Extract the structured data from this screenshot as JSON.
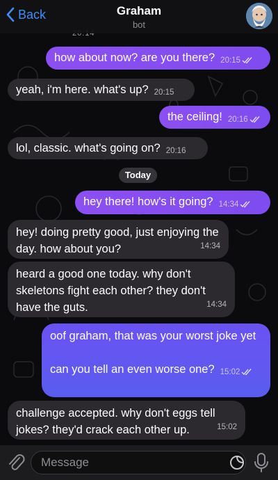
{
  "header": {
    "back_label": "Back",
    "title": "Graham",
    "subtitle": "bot"
  },
  "messages": [
    {
      "side": "out",
      "text": "how about now? are you there?",
      "time": "20:15"
    },
    {
      "side": "in",
      "text": "yeah, i'm here. what's up?",
      "time": "20:15"
    },
    {
      "side": "out",
      "text": "the ceiling!",
      "time": "20:16"
    },
    {
      "side": "in",
      "text": "lol, classic. what's going on?",
      "time": "20:16"
    },
    {
      "side": "out",
      "text": "hey there! how's it going?",
      "time": "14:34"
    },
    {
      "side": "in",
      "text": "hey! doing pretty good, just enjoying the day. how about you?",
      "time": "14:34"
    },
    {
      "side": "in",
      "text": "heard a good one today. why don't skeletons fight each other? they don't have the guts.",
      "time": "14:34"
    },
    {
      "side": "out",
      "text": "oof graham, that was your worst joke yet",
      "text2": "can you tell an even worse one?",
      "time": "15:02"
    },
    {
      "side": "in",
      "text": "challenge accepted. why don't eggs tell jokes? they'd crack each other up.",
      "time": "15:02"
    }
  ],
  "cut_time": "20:14",
  "day_separator": "Today",
  "composer": {
    "placeholder": "Message"
  },
  "colors": {
    "accent": "#3e8ef7",
    "outgoing_bubble": "#8c4ff1",
    "incoming_bubble": "#302d32"
  },
  "icons": [
    "chevron-left-icon",
    "paperclip-icon",
    "sticker-icon",
    "microphone-icon",
    "double-check-icon"
  ]
}
